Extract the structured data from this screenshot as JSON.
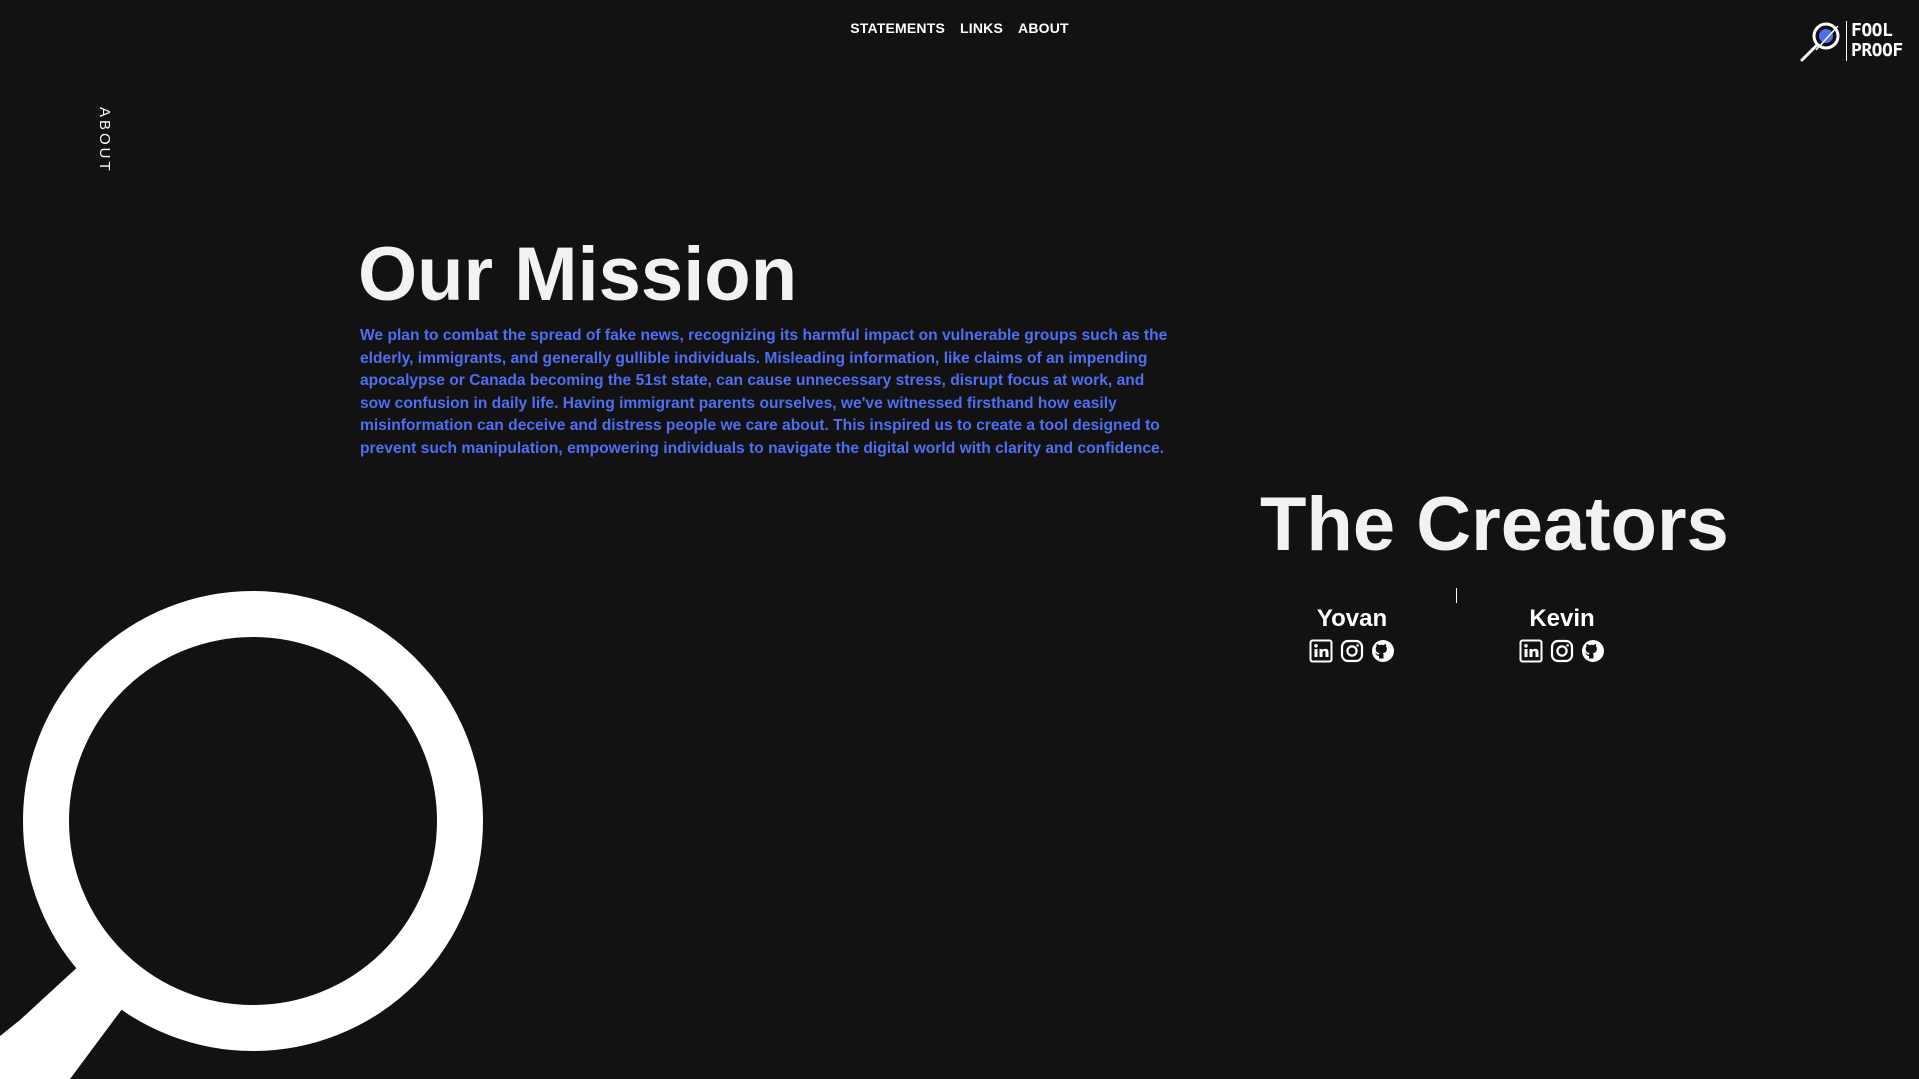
{
  "nav": {
    "items": [
      {
        "label": "STATEMENTS"
      },
      {
        "label": "LINKS"
      },
      {
        "label": "ABOUT"
      }
    ]
  },
  "logo": {
    "line1": "FOOL",
    "line2": "PROOF",
    "icon": "magnifier-logo-icon",
    "accent": "#4f6ef2"
  },
  "side_label": "ABOUT",
  "mission": {
    "title": "Our Mission",
    "body": "We plan to combat the spread of fake news, recognizing its harmful impact on vulnerable groups such as the elderly, immigrants, and generally gullible individuals. Misleading information, like claims of an impending apocalypse or Canada becoming the 51st state, can cause unnecessary stress, disrupt focus at work, and sow confusion in daily life. Having immigrant parents ourselves, we've witnessed firsthand how easily misinformation can deceive and distress people we care about. This inspired us to create a tool designed to prevent such manipulation, empowering individuals to navigate the digital world with clarity and confidence."
  },
  "creators": {
    "title": "The Creators",
    "people": [
      {
        "name": "Yovan",
        "icons": [
          "linkedin-icon",
          "instagram-icon",
          "github-icon"
        ]
      },
      {
        "name": "Kevin",
        "icons": [
          "linkedin-icon",
          "instagram-icon",
          "github-icon"
        ]
      }
    ]
  },
  "colors": {
    "background": "#121212",
    "text": "#f2f2f2",
    "accent": "#4f6ef2"
  }
}
